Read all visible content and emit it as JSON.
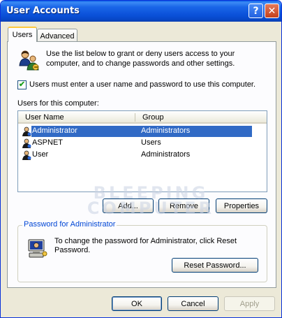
{
  "window": {
    "title": "User Accounts",
    "help_glyph": "?",
    "close_glyph": "✕"
  },
  "tabs": [
    {
      "label": "Users",
      "active": true
    },
    {
      "label": "Advanced",
      "active": false
    }
  ],
  "intro": {
    "icon": "users-icon",
    "text": "Use the list below to grant or deny users access to your computer, and to change passwords and other settings."
  },
  "require_login": {
    "checked": true,
    "label": "Users must enter a user name and password to use this computer."
  },
  "users_list": {
    "label": "Users for this computer:",
    "columns": [
      "User Name",
      "Group"
    ],
    "rows": [
      {
        "name": "Administrator",
        "group": "Administrators",
        "selected": true,
        "icon": "user-icon"
      },
      {
        "name": "ASPNET",
        "group": "Users",
        "selected": false,
        "icon": "user-icon"
      },
      {
        "name": "User",
        "group": "Administrators",
        "selected": false,
        "icon": "user-icon"
      }
    ]
  },
  "list_buttons": {
    "add": "Add...",
    "remove": "Remove",
    "properties": "Properties"
  },
  "password_group": {
    "title": "Password for Administrator",
    "icon": "computer-password-icon",
    "text": "To change the password for Administrator, click Reset Password.",
    "reset_button": "Reset Password..."
  },
  "watermark": {
    "line1": "BLEEPING",
    "line2": "COMPUTER"
  },
  "dialog_buttons": {
    "ok": "OK",
    "cancel": "Cancel",
    "apply": "Apply"
  },
  "colors": {
    "title_bar": "#0A50D8",
    "dialog_bg": "#ECE9D8",
    "selection": "#316AC5",
    "group_title": "#0046D5"
  }
}
